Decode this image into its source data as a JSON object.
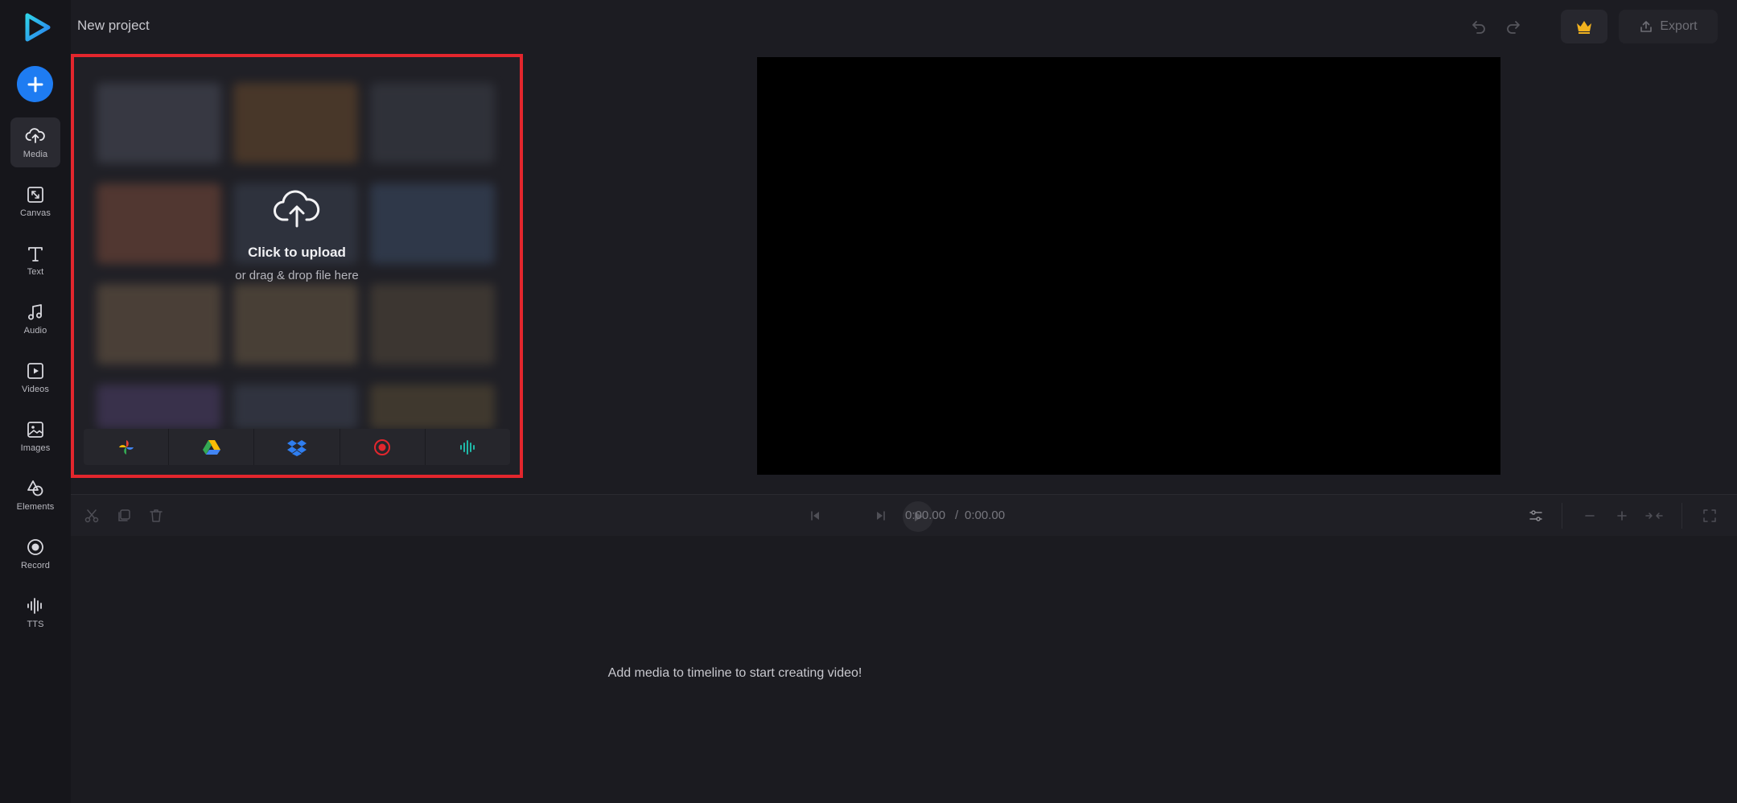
{
  "header": {
    "project_title": "New project",
    "export_label": "Export"
  },
  "sidebar": {
    "items": [
      {
        "label": "Media",
        "icon": "cloud-upload-icon",
        "active": true
      },
      {
        "label": "Canvas",
        "icon": "canvas-resize-icon",
        "active": false
      },
      {
        "label": "Text",
        "icon": "text-icon",
        "active": false
      },
      {
        "label": "Audio",
        "icon": "music-note-icon",
        "active": false
      },
      {
        "label": "Videos",
        "icon": "video-play-icon",
        "active": false
      },
      {
        "label": "Images",
        "icon": "image-icon",
        "active": false
      },
      {
        "label": "Elements",
        "icon": "shapes-icon",
        "active": false
      },
      {
        "label": "Record",
        "icon": "record-icon",
        "active": false
      },
      {
        "label": "TTS",
        "icon": "soundwave-icon",
        "active": false
      }
    ]
  },
  "media_panel": {
    "upload_title": "Click to upload",
    "upload_subtitle": "or drag & drop file here",
    "sources": [
      "google-photos-icon",
      "google-drive-icon",
      "dropbox-icon",
      "record-camera-icon",
      "tts-icon"
    ]
  },
  "timeline": {
    "current_time": "0:00.00",
    "separator": "/",
    "total_time": "0:00.00",
    "empty_message": "Add media to timeline to start creating video!"
  },
  "colors": {
    "accent": "#1e7cf2",
    "highlight_border": "#e3262d",
    "crown": "#f2b21e"
  }
}
